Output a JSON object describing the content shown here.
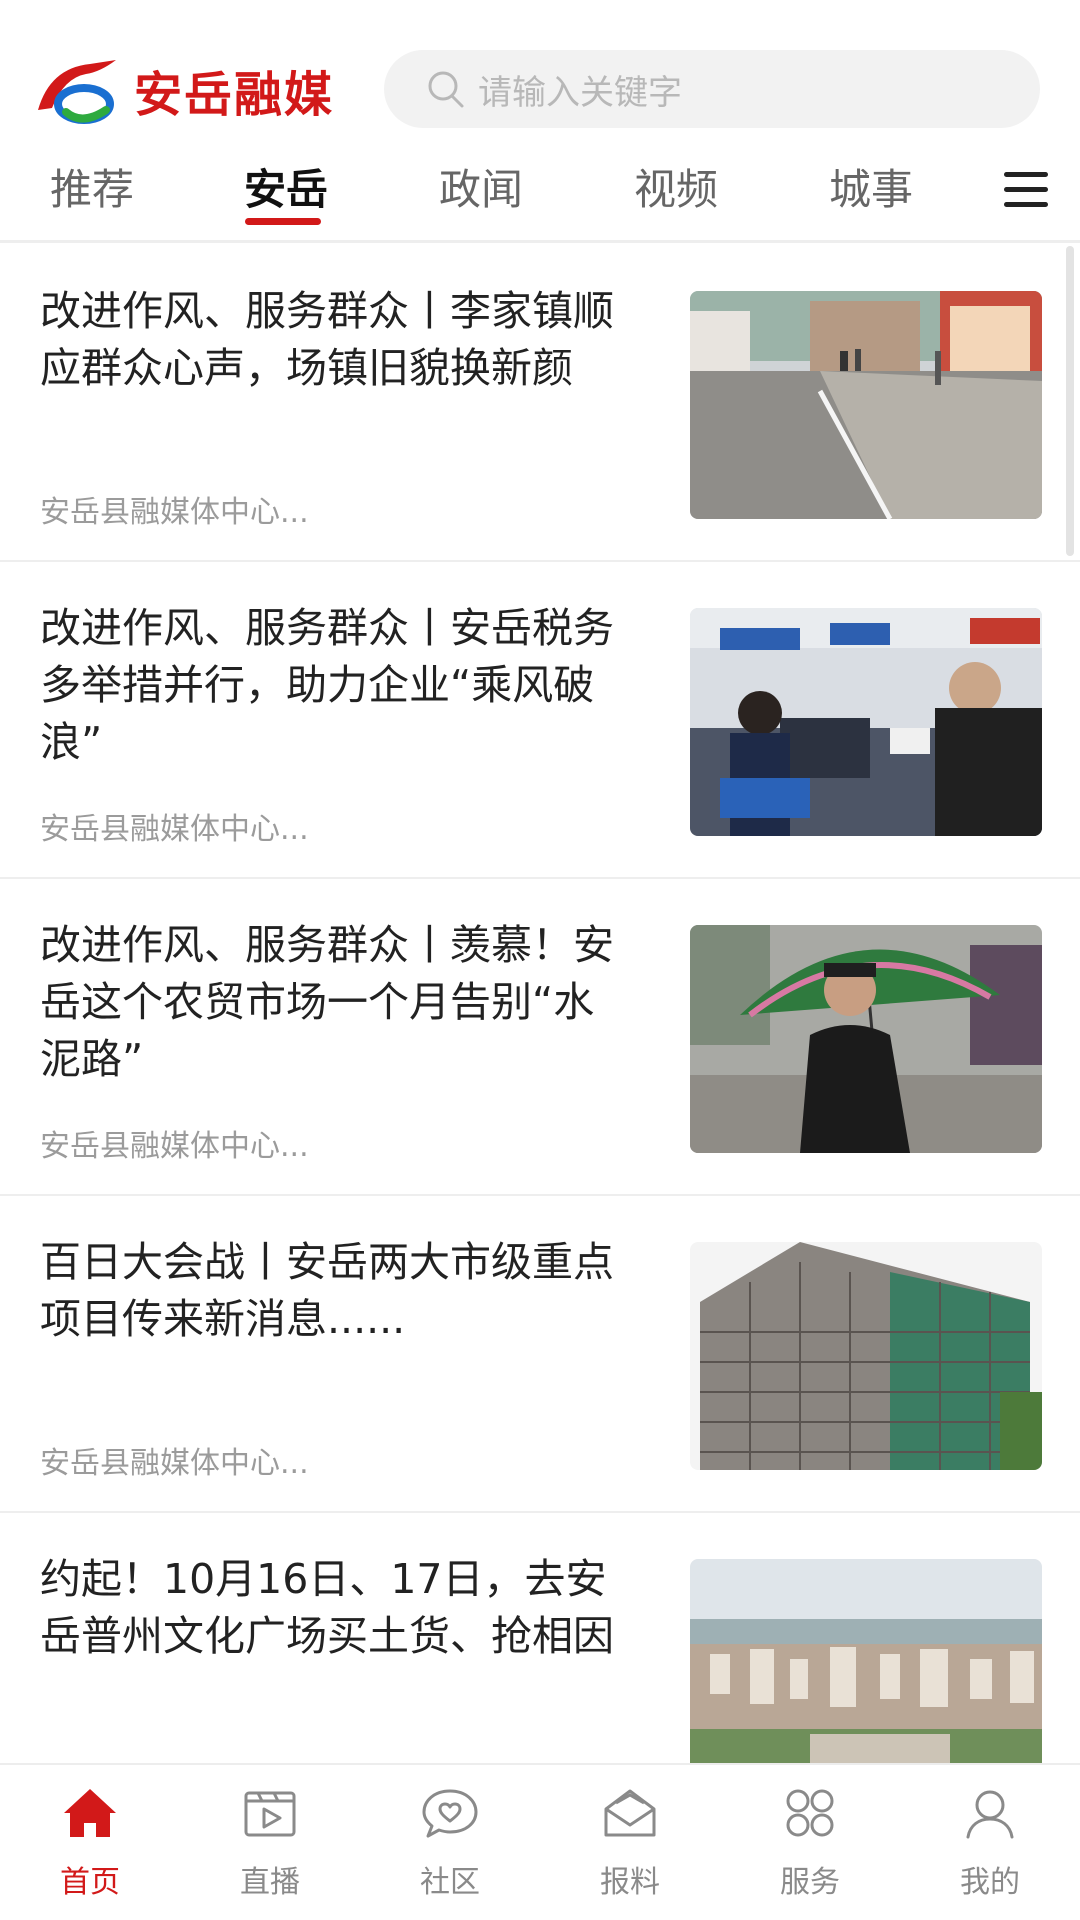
{
  "header": {
    "logo_text": "安岳融媒",
    "search_placeholder": "请输入关键字",
    "brand_color": "#d21919"
  },
  "tabs": [
    {
      "label": "推荐",
      "active": false
    },
    {
      "label": "安岳",
      "active": true
    },
    {
      "label": "政闻",
      "active": false
    },
    {
      "label": "视频",
      "active": false
    },
    {
      "label": "城事",
      "active": false
    }
  ],
  "articles": [
    {
      "title": "改进作风、服务群众丨李家镇顺应群众心声，场镇旧貌换新颜",
      "source": "安岳县融媒体中心...",
      "thumb": "street-scene"
    },
    {
      "title": "改进作风、服务群众丨安岳税务多举措并行，助力企业“乘风破浪”",
      "source": "安岳县融媒体中心...",
      "thumb": "tax-service-hall"
    },
    {
      "title": "改进作风、服务群众丨羡慕！安岳这个农贸市场一个月告别“水泥路”",
      "source": "安岳县融媒体中心...",
      "thumb": "man-with-umbrella"
    },
    {
      "title": "百日大会战丨安岳两大市级重点项目传来新消息......",
      "source": "安岳县融媒体中心...",
      "thumb": "construction-building"
    },
    {
      "title": "约起！10月16日、17日，去安岳普州文化广场买土货、抢相因",
      "source": "",
      "thumb": "city-aerial"
    }
  ],
  "bottom_nav": [
    {
      "label": "首页",
      "icon": "home-icon",
      "active": true
    },
    {
      "label": "直播",
      "icon": "live-icon",
      "active": false
    },
    {
      "label": "社区",
      "icon": "community-icon",
      "active": false
    },
    {
      "label": "报料",
      "icon": "report-icon",
      "active": false
    },
    {
      "label": "服务",
      "icon": "service-icon",
      "active": false
    },
    {
      "label": "我的",
      "icon": "profile-icon",
      "active": false
    }
  ]
}
